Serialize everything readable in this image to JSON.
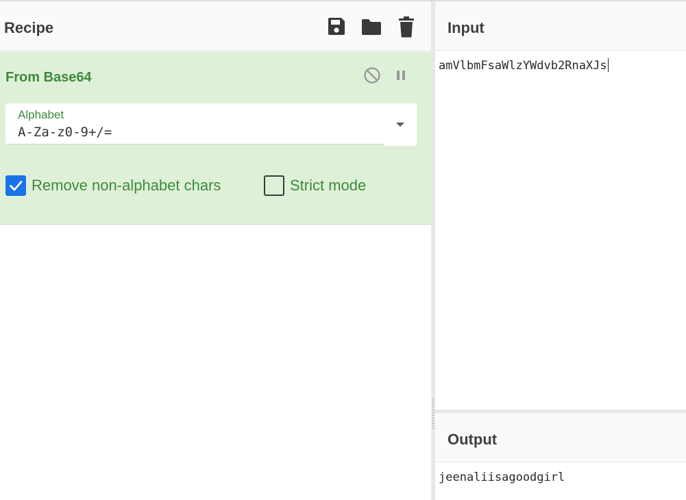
{
  "recipe": {
    "title": "Recipe",
    "actions": [
      {
        "name": "save-recipe",
        "icon": "floppy-disk-icon"
      },
      {
        "name": "load-recipe",
        "icon": "folder-icon"
      },
      {
        "name": "clear-recipe",
        "icon": "trash-icon"
      }
    ]
  },
  "operation": {
    "title": "From Base64",
    "disable_icon": "disable-circle-icon",
    "pause_icon": "pause-icon",
    "alphabet": {
      "label": "Alphabet",
      "value": "A-Za-z0-9+/="
    },
    "options": [
      {
        "label": "Remove non-alphabet chars",
        "checked": true
      },
      {
        "label": "Strict mode",
        "checked": false
      }
    ]
  },
  "input": {
    "title": "Input",
    "text": "amVlbmFsaWlzYWdvb2RnaXJs"
  },
  "output": {
    "title": "Output",
    "text": "jeenaliisagoodgirl"
  },
  "colors": {
    "operation_bg": "#dff0d8",
    "operation_text": "#3c8a3c",
    "checkbox_checked": "#1a73e8"
  }
}
